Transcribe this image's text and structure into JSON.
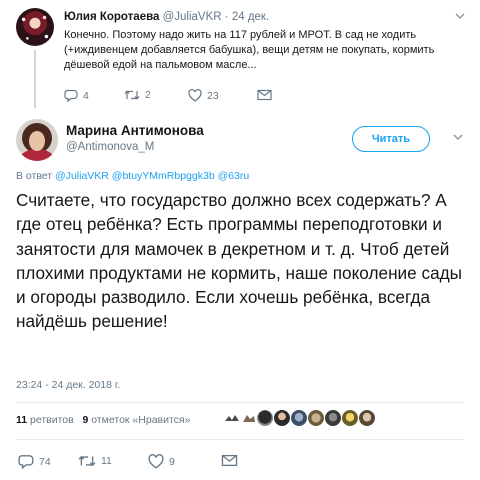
{
  "parent_tweet": {
    "name": "Юлия Коротаева",
    "handle": "@JuliaVKR",
    "separator": "·",
    "date": "24 дек.",
    "text": "Конечно. Поэтому надо жить на 117 рублей и МРОТ. В сад не ходить (+иждивенцем добавляется бабушка), вещи детям не покупать, кормить дёшевой едой на пальмовом масле...",
    "reply_count": "4",
    "retweet_count": "2",
    "like_count": "23"
  },
  "main_tweet": {
    "name": "Марина Антимонова",
    "handle": "@Antimonova_M",
    "follow_label": "Читать",
    "reply_prefix": "В ответ",
    "mentions": [
      "@JuliaVKR",
      "@btuyYMmRbpggk3b",
      "@63ru"
    ],
    "text": "Считаете, что государство должно всех содержать?  А где отец ребёнка? Есть программы переподготовки и занятости для мамочек в декретном и т. д. Чтоб детей плохими продуктами не кормить, наше поколение сады и огороды разводило. Если хочешь ребёнка, всегда найдёшь решение!",
    "timestamp": "23:24 - 24 дек. 2018 г.",
    "retweets_count": "11",
    "retweets_label": "ретвитов",
    "likes_count": "9",
    "likes_label": "отметок «Нравится»",
    "reply_count": "74",
    "retweet_count": "11",
    "like_count": "9"
  },
  "colors": {
    "accent": "#1da1f2",
    "secondary_text": "#657786",
    "primary_text": "#14171a",
    "divider": "#e6ecf0"
  },
  "icons": [
    "chevron-down-icon",
    "reply-icon",
    "retweet-icon",
    "like-icon",
    "envelope-icon"
  ]
}
